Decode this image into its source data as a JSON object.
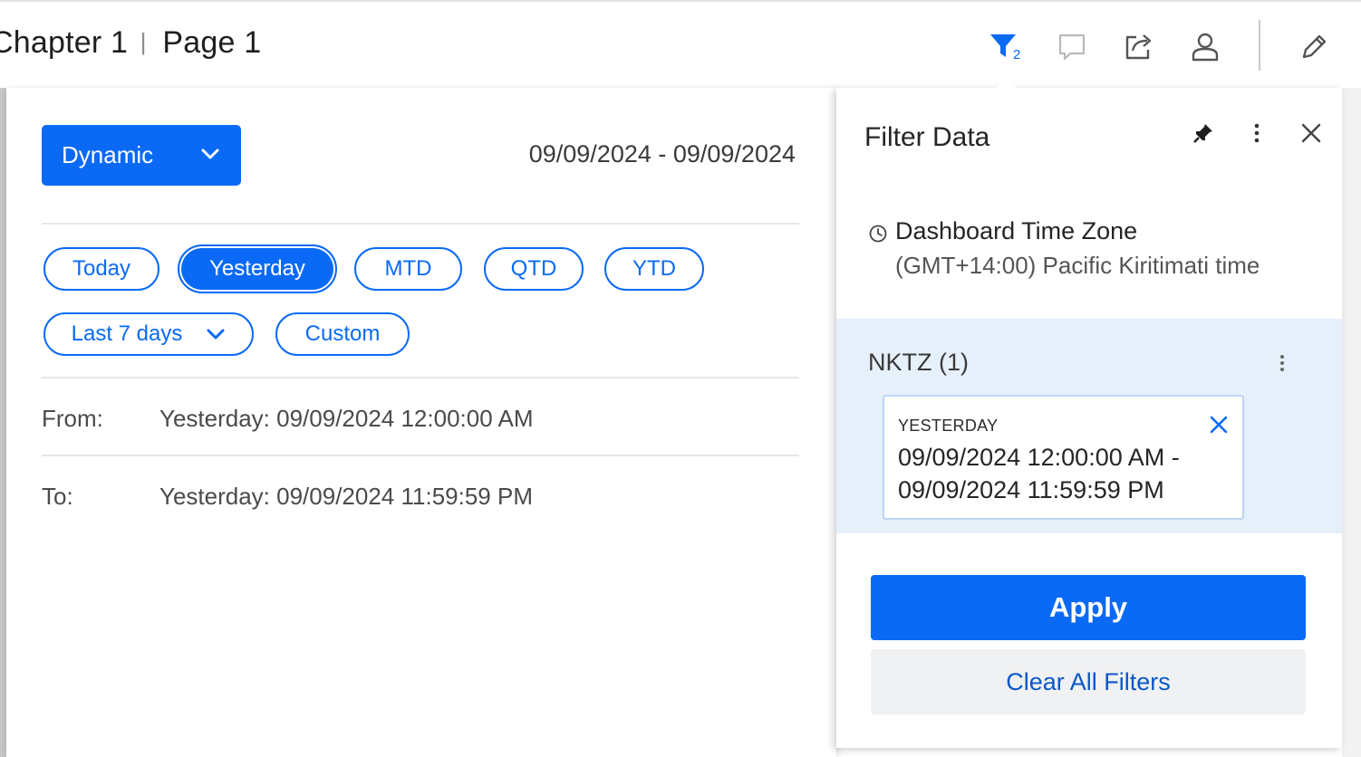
{
  "header": {
    "chapter": "Chapter 1",
    "separator": "|",
    "page": "Page 1",
    "filter_count": "2"
  },
  "date_panel": {
    "mode_label": "Dynamic",
    "range_text": "09/09/2024 - 09/09/2024",
    "pills": [
      "Today",
      "Yesterday",
      "MTD",
      "QTD",
      "YTD"
    ],
    "active_pill": "Yesterday",
    "last_days_label": "Last 7 days",
    "custom_label": "Custom",
    "from_label": "From:",
    "from_value": "Yesterday: 09/09/2024 12:00:00 AM",
    "to_label": "To:",
    "to_value": "Yesterday: 09/09/2024 11:59:59 PM"
  },
  "filter_panel": {
    "title": "Filter Data",
    "timezone_title": "Dashboard Time Zone",
    "timezone_value": "(GMT+14:00) Pacific Kiritimati time",
    "field_title": "NKTZ (1)",
    "chip_label": "YESTERDAY",
    "chip_line1": "09/09/2024 12:00:00 AM -",
    "chip_line2": "09/09/2024 11:59:59 PM",
    "apply_label": "Apply",
    "clear_label": "Clear All Filters"
  },
  "colors": {
    "accent": "#0a6af5",
    "section_bg": "#e6f0fb"
  }
}
